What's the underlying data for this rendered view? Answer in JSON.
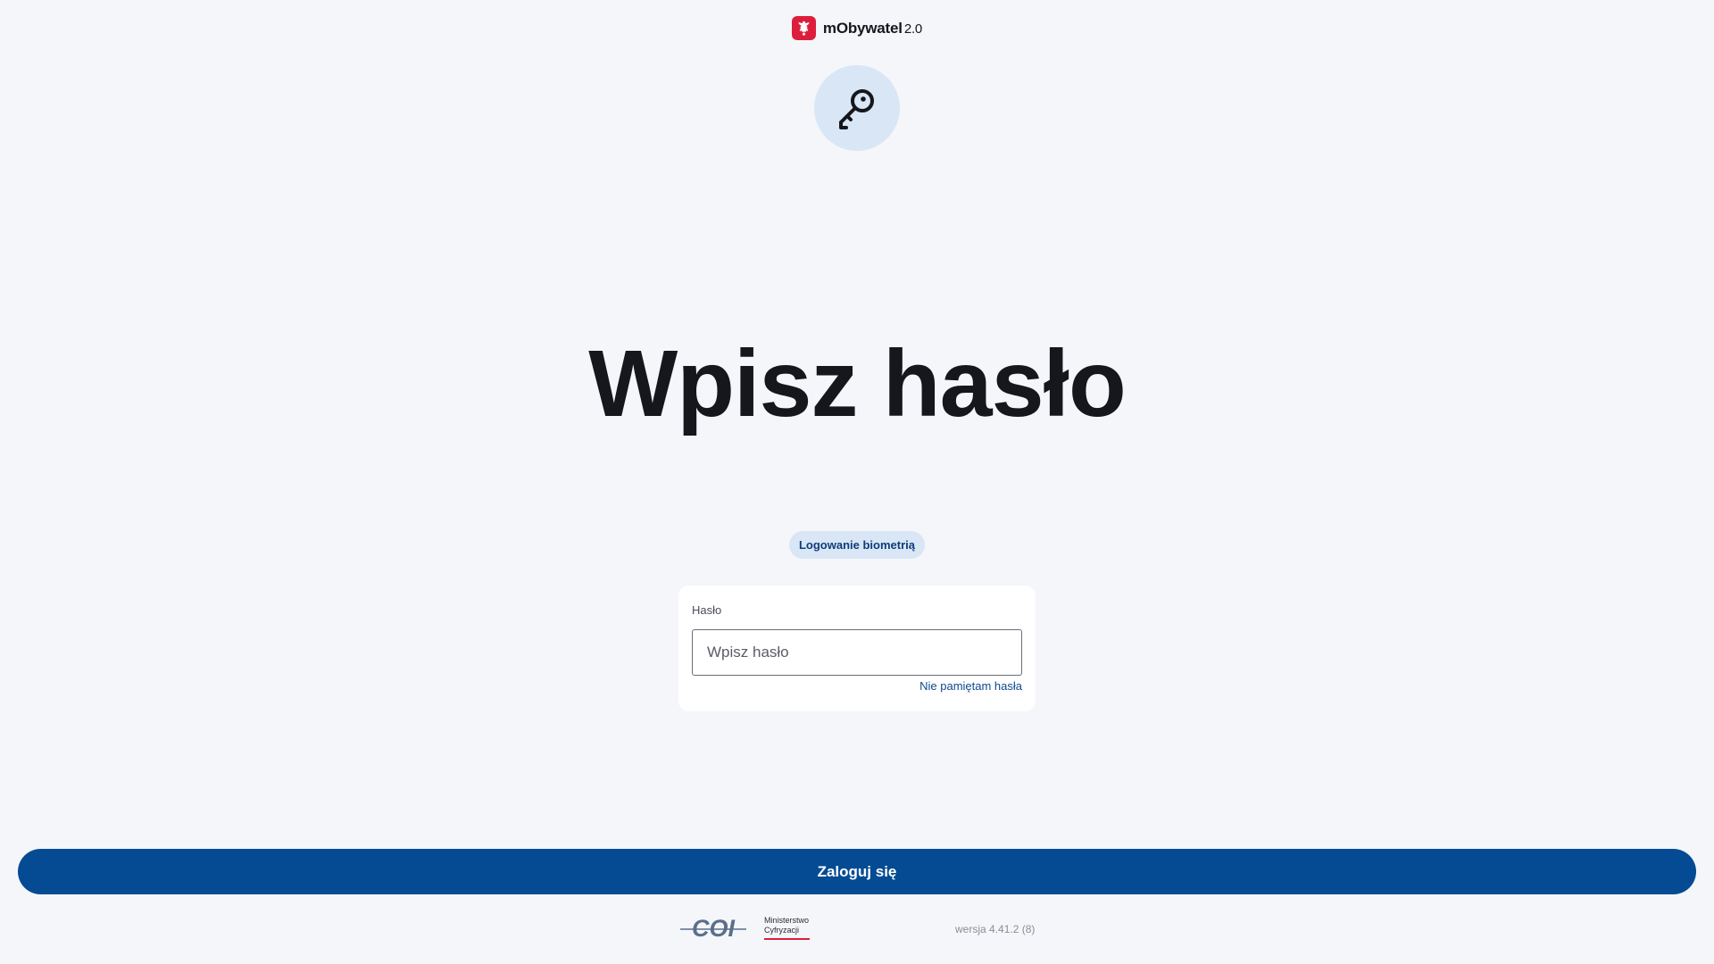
{
  "header": {
    "app_name": "mObywatel",
    "app_version": "2.0",
    "logo_icon": "eagle-emblem-icon",
    "logo_color": "#dc1e3c"
  },
  "hero": {
    "icon": "key-icon",
    "title": "Wpisz hasło"
  },
  "biometric": {
    "label": "Logowanie biometrią"
  },
  "password_form": {
    "label": "Hasło",
    "value": "",
    "placeholder": "Wpisz hasło",
    "forgot_label": "Nie pamiętam hasła"
  },
  "actions": {
    "login_label": "Zaloguj się",
    "primary_color": "#044b93"
  },
  "footer": {
    "coi_logo": "COI",
    "ministry_text": [
      "Ministerstwo",
      "Cyfryzacji"
    ],
    "version_text": "wersja 4.41.2 (8)"
  },
  "colors": {
    "background": "#f5f6fa",
    "accent_light": "#d9e6f6",
    "link": "#0f4a8f"
  }
}
